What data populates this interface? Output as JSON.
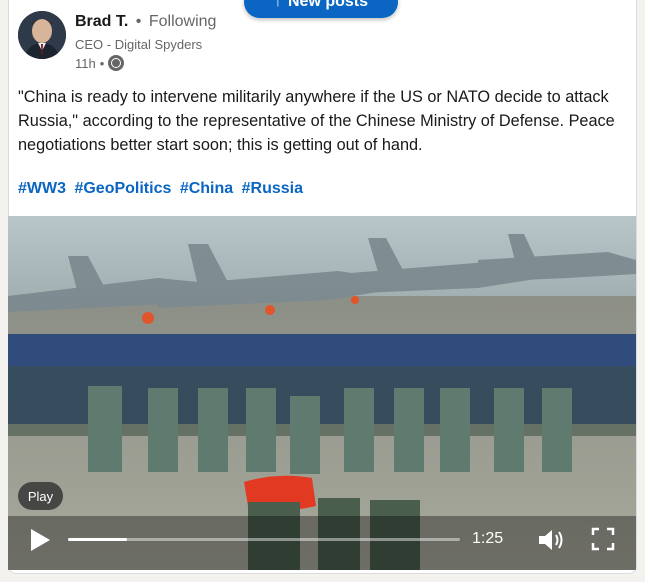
{
  "banner": {
    "new_posts_label": "New posts",
    "arrow_icon": "arrow-up-icon"
  },
  "author": {
    "name": "Brad T.",
    "separator": "•",
    "follow_status": "Following",
    "headline": "CEO - Digital Spyders",
    "time_ago": "11h",
    "meta_separator": "•",
    "visibility_icon": "globe-icon"
  },
  "post": {
    "text": "\"China is ready to intervene militarily anywhere if the US or NATO decide to attack Russia,\" according to the representative of the Chinese Ministry of Defense. Peace negotiations better start soon; this is getting out of hand.",
    "hashtags": [
      "#WW3",
      "#GeoPolitics",
      "#China",
      "#Russia"
    ]
  },
  "video": {
    "play_badge": "Play",
    "duration": "1:25",
    "progress_fraction": 0.15,
    "controls_icons": [
      "play-icon",
      "volume-icon",
      "fullscreen-icon"
    ]
  },
  "colors": {
    "accent": "#0a66c2",
    "text": "#191919",
    "muted": "#666666"
  }
}
